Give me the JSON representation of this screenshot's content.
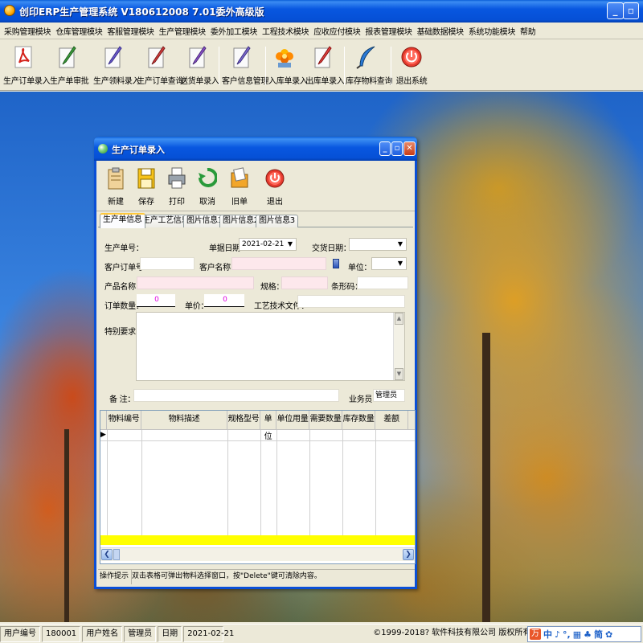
{
  "app": {
    "title": "创印ERP生产管理系统  V180612008  7.01委外高级版"
  },
  "window_controls": {
    "minimize": "_",
    "restore": "▫",
    "close": "✕"
  },
  "menu": [
    "采购管理模块",
    "仓库管理模块",
    "客服管理模块",
    "生产管理模块",
    "委外加工模块",
    "工程技术模块",
    "应收应付模块",
    "报表管理模块",
    "基础数据模块",
    "系统功能模块",
    "帮助"
  ],
  "toolbar": [
    {
      "label": "生产订单录入",
      "icon": "pdf-icon"
    },
    {
      "label": "生产单审批",
      "icon": "approve-pen-icon"
    },
    {
      "label": "生产领料录入",
      "icon": "material-pen-icon"
    },
    {
      "label": "生产订单查询",
      "icon": "query-pen-icon"
    },
    {
      "label": "送货单录入",
      "icon": "delivery-pen-icon"
    },
    {
      "label": "客户信息管理",
      "icon": "customer-pen-icon"
    },
    {
      "label": "入库单录入",
      "icon": "inbound-flower-icon"
    },
    {
      "label": "出库单录入",
      "icon": "outbound-pen-icon"
    },
    {
      "label": "库存物料查询",
      "icon": "stock-feather-icon"
    },
    {
      "label": "退出系统",
      "icon": "exit-icon"
    }
  ],
  "child": {
    "title": "生产订单录入",
    "toolbar": [
      {
        "label": "新建",
        "icon": "new-clipboard-icon"
      },
      {
        "label": "保存",
        "icon": "save-floppy-icon"
      },
      {
        "label": "打印",
        "icon": "print-icon"
      },
      {
        "label": "取消",
        "icon": "cancel-recycle-icon"
      },
      {
        "label": "旧单",
        "icon": "old-order-folder-icon"
      },
      {
        "label": "退出",
        "icon": "exit-icon"
      }
    ],
    "tabs": [
      "生产单信息",
      "生产工艺信息",
      "图片信息1",
      "图片信息2",
      "图片信息3"
    ],
    "active_tab": 0,
    "form": {
      "order_no_label": "生产单号：",
      "order_no_value": "",
      "date_label": "单据日期：",
      "date_value": "2021-02-21",
      "delivery_label": "交货日期：",
      "delivery_value": "",
      "cust_order_label": "客户订单号：",
      "cust_order_value": "",
      "customer_label": "客户名称：",
      "customer_value": "",
      "unit_label": "单位：",
      "unit_value": "",
      "product_label": "产品名称：",
      "product_value": "",
      "spec_label": "规格：",
      "spec_value": "",
      "barcode_label": "条形码：",
      "barcode_value": "",
      "qty_label": "订单数量：",
      "qty_value": "0",
      "price_label": "单价：",
      "price_value": "0",
      "craft_file_label": "工艺技术文件：",
      "craft_file_value": "",
      "special_label": "特别要求：",
      "remark_label": "备 注：",
      "remark_value": "",
      "salesman_label": "业务员：",
      "salesman_value": "管理员"
    },
    "grid": {
      "columns": [
        "物料编号",
        "物料描述",
        "规格型号",
        "单位",
        "单位用量",
        "需要数量",
        "库存数量",
        "差额"
      ],
      "rows": []
    },
    "hint": {
      "label": "操作提示",
      "text": "双击表格可弹出物料选择窗口，按\"Delete\"键可清除内容。"
    }
  },
  "status": {
    "user_no_label": "用户编号",
    "user_no": "180001",
    "user_name_label": "用户姓名",
    "user_name": "管理员",
    "date_label": "日期",
    "date": "2021-02-21",
    "copyright": "©1999-2018?  软件科技有限公司  版权所有"
  },
  "ime": [
    "中",
    "♪",
    "°,",
    "▦",
    "♣",
    "简",
    "✿"
  ],
  "colors": {
    "titlebar": "#0857e0",
    "highlight_row": "#ffff00",
    "pink_field": "#fde8ec",
    "qty_text": "#e000e0"
  }
}
